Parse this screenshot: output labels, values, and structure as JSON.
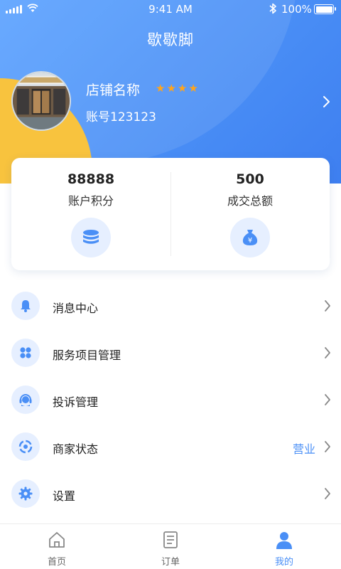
{
  "status_bar": {
    "time": "9:41 AM",
    "battery": "100%"
  },
  "app": {
    "title": "歇歇脚"
  },
  "shop": {
    "name": "店铺名称",
    "account": "账号123123",
    "rating": 4,
    "star_glyph": "★"
  },
  "stats": [
    {
      "value": "88888",
      "label": "账户积分",
      "icon": "coins-stack-icon"
    },
    {
      "value": "500",
      "label": "成交总额",
      "icon": "money-bag-icon"
    }
  ],
  "menu": {
    "items": [
      {
        "label": "消息中心",
        "icon": "bell-icon",
        "value": ""
      },
      {
        "label": "服务项目管理",
        "icon": "grid-icon",
        "value": ""
      },
      {
        "label": "投诉管理",
        "icon": "headset-icon",
        "value": ""
      },
      {
        "label": "商家状态",
        "icon": "status-ring-icon",
        "value": "营业"
      },
      {
        "label": "设置",
        "icon": "gear-icon",
        "value": ""
      }
    ]
  },
  "tabbar": {
    "tabs": [
      {
        "label": "首页",
        "icon": "home-icon",
        "active": false
      },
      {
        "label": "订单",
        "icon": "order-list-icon",
        "active": false
      },
      {
        "label": "我的",
        "icon": "user-icon",
        "active": true
      }
    ]
  },
  "colors": {
    "primary": "#4a8ff6",
    "accent_yellow": "#f8c33e",
    "star": "#ffa41b",
    "icon_bg": "#e6efff"
  }
}
